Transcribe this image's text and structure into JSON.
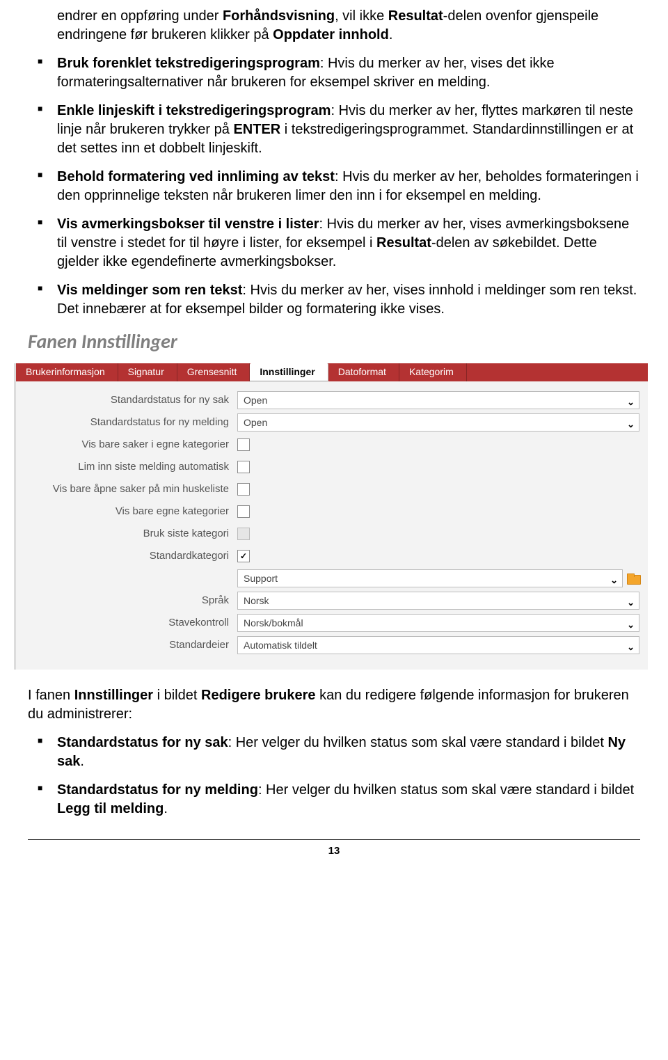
{
  "paragraphs": {
    "p0_a": "endrer en oppføring under ",
    "p0_b": "Forhåndsvisning",
    "p0_c": ", vil ikke ",
    "p0_d": "Resultat",
    "p0_e": "-delen ovenfor gjenspeile endringene før brukeren klikker på ",
    "p0_f": "Oppdater innhold",
    "p0_g": ".",
    "p1_a": "Bruk forenklet tekstredigeringsprogram",
    "p1_b": ": Hvis du merker av her, vises det ikke formateringsalternativer når brukeren for eksempel skriver en melding.",
    "p2_a": "Enkle linjeskift i tekstredigeringsprogram",
    "p2_b": ": Hvis du merker av her, flyttes markøren til neste linje når brukeren trykker på ",
    "p2_c": "ENTER",
    "p2_d": " i tekstredigeringsprogrammet. Standardinnstillingen er at det settes inn et dobbelt linjeskift.",
    "p3_a": "Behold formatering ved innliming av tekst",
    "p3_b": ": Hvis du merker av her, beholdes formateringen i den opprinnelige teksten når brukeren limer den inn i for eksempel en melding.",
    "p4_a": "Vis avmerkingsbokser til venstre i lister",
    "p4_b": ": Hvis du merker av her, vises avmerkingsboksene til venstre i stedet for til høyre i lister, for eksempel i ",
    "p4_c": "Resultat",
    "p4_d": "-delen av søkebildet. Dette gjelder ikke egendefinerte avmerkingsbokser.",
    "p5_a": "Vis meldinger som ren tekst",
    "p5_b": ": Hvis du merker av her, vises innhold i meldinger som ren tekst. Det innebærer at for eksempel bilder og formatering ikke vises."
  },
  "heading": "Fanen Innstillinger",
  "ui": {
    "tabs": [
      "Brukerinformasjon",
      "Signatur",
      "Grensesnitt",
      "Innstillinger",
      "Datoformat",
      "Kategorim"
    ],
    "rows": {
      "r1": {
        "label": "Standardstatus for ny sak",
        "value": "Open"
      },
      "r2": {
        "label": "Standardstatus for ny melding",
        "value": "Open"
      },
      "r3": {
        "label": "Vis bare saker i egne kategorier"
      },
      "r4": {
        "label": "Lim inn siste melding automatisk"
      },
      "r5": {
        "label": "Vis bare åpne saker på min huskeliste"
      },
      "r6": {
        "label": "Vis bare egne kategorier"
      },
      "r7": {
        "label": "Bruk siste kategori"
      },
      "r8": {
        "label": "Standardkategori"
      },
      "r9": {
        "value": "Support"
      },
      "r10": {
        "label": "Språk",
        "value": "Norsk"
      },
      "r11": {
        "label": "Stavekontroll",
        "value": "Norsk/bokmål"
      },
      "r12": {
        "label": "Standardeier",
        "value": "Automatisk tildelt"
      }
    }
  },
  "after": {
    "a1_a": "I fanen ",
    "a1_b": "Innstillinger",
    "a1_c": " i bildet ",
    "a1_d": "Redigere brukere",
    "a1_e": " kan du redigere følgende informasjon for brukeren du administrerer:",
    "b1_a": "Standardstatus for ny sak",
    "b1_b": ": Her velger du hvilken status som skal være standard i bildet ",
    "b1_c": "Ny sak",
    "b1_d": ".",
    "b2_a": "Standardstatus for ny melding",
    "b2_b": ": Her velger du hvilken status som skal være standard i bildet ",
    "b2_c": "Legg til melding",
    "b2_d": "."
  },
  "page_number": "13"
}
